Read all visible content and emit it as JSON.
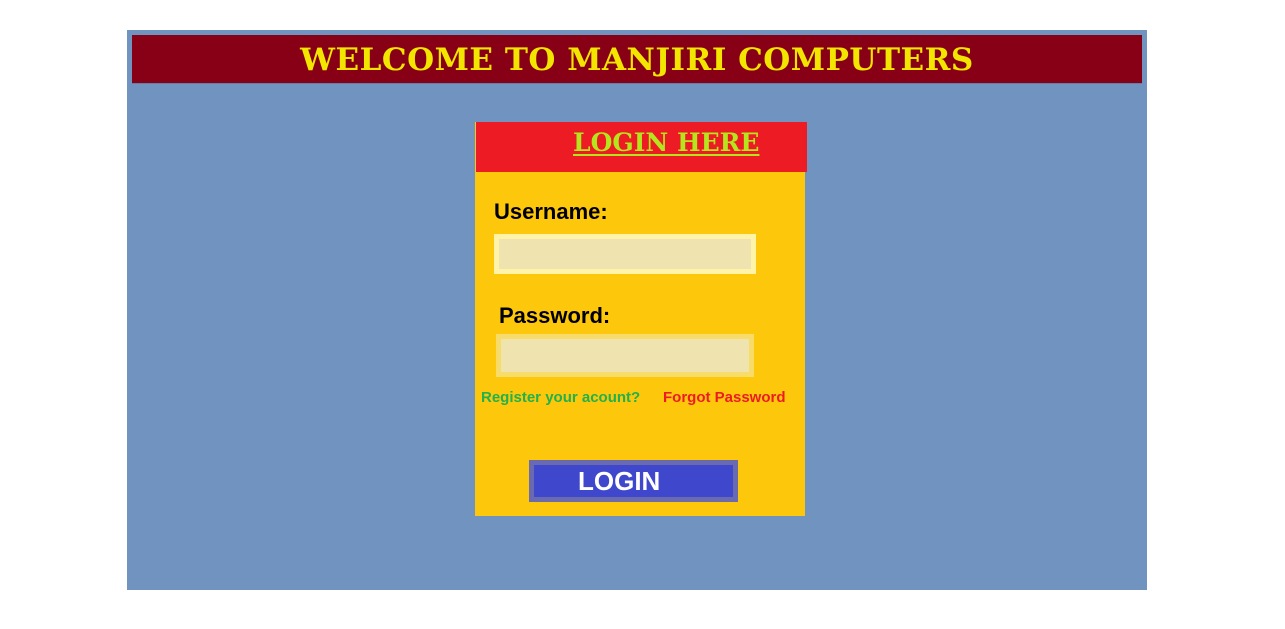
{
  "header": {
    "title": "WELCOME TO MANJIRI COMPUTERS"
  },
  "login_card": {
    "title": "LOGIN HERE",
    "username_label": "Username:",
    "username_value": "",
    "password_label": "Password:",
    "password_value": "",
    "register_link": "Register your acount?",
    "forgot_link": "Forgot Password",
    "login_button": "LOGIN"
  },
  "colors": {
    "page_background": "#ffffff",
    "frame_background": "#7093bf",
    "header_background": "#870016",
    "header_text": "#f2e500",
    "card_background": "#fdc70b",
    "card_header_background": "#ed1c24",
    "card_title_text": "#b5e61d",
    "input_background": "#efe4b0",
    "register_link": "#22b14c",
    "forgot_link": "#ed1c24",
    "button_background": "#3f48cc",
    "button_text": "#ffffff"
  }
}
